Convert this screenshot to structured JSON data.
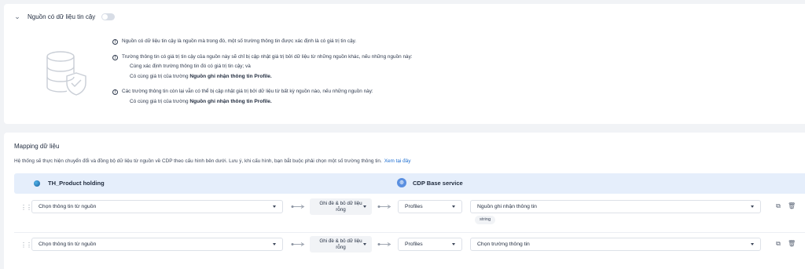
{
  "trust_section": {
    "title": "Nguồn có dữ liệu tin cậy",
    "toggle_on": false,
    "info": {
      "item1": "Nguồn có dữ liệu tin cậy là nguồn mà trong đó, một số trường thông tin được xác định là có giá trị tin cậy.",
      "item2": "Trường thông tin có giá trị tin cậy của nguồn này sẽ chỉ bị cập nhật giá trị bởi dữ liệu từ những nguồn khác, nếu những nguồn này:",
      "item2_sub1": "Cùng xác định trường thông tin đó có giá trị tin cậy; và",
      "item2_sub2_prefix": "Có cùng giá trị của trường ",
      "item2_sub2_bold": "Nguồn ghi nhận thông tin Profile.",
      "item3": "Các trường thông tin còn lại vẫn có thể bị cập nhật giá trị bởi dữ liệu từ bất kỳ nguồn nào, nếu những nguồn này:",
      "item3_sub1_prefix": "Có cùng giá trị của trường ",
      "item3_sub1_bold": "Nguồn ghi nhận thông tin Profile."
    }
  },
  "mapping": {
    "title": "Mapping dữ liệu",
    "description": "Hệ thống sẽ thực hiện chuyển đổi và đồng bộ dữ liệu từ nguồn về CDP theo cấu hình bên dưới. Lưu ý, khi cấu hình, bạn bắt buộc phải chọn một số trường thông tin.",
    "link": "Xem tại đây",
    "source_name": "TH_Product holding",
    "dest_name": "CDP Base service",
    "rows": [
      {
        "source": "Chọn thông tin từ nguồn",
        "mode": "Ghi đè & bỏ dữ liệu rỗng",
        "object": "Profiles",
        "field": "Nguồn ghi nhận thông tin",
        "type_tag": "string"
      },
      {
        "source": "Chọn thông tin từ nguồn",
        "mode": "Ghi đè & bỏ dữ liệu rỗng",
        "object": "Profiles",
        "field": "Chọn trường thông tin"
      }
    ]
  },
  "colors": {
    "accent": "#1f6fd1",
    "header_bg": "#e5eefb",
    "page_bg": "#f1f3f6"
  }
}
